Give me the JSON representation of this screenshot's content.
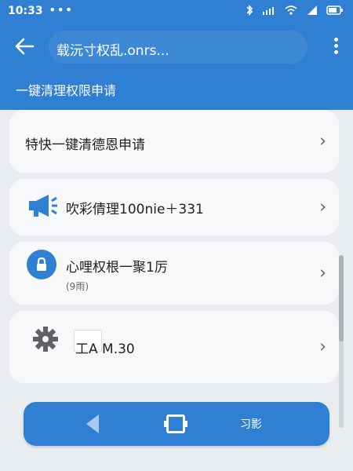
{
  "status": {
    "time": "10:33",
    "dots": "•••",
    "icons": [
      "bluetooth-icon",
      "signal-bars-icon",
      "wifi-icon",
      "cellular-icon",
      "battery-icon"
    ]
  },
  "appbar": {
    "title": "载沅寸权乱.onrs..."
  },
  "subtitle": "一键清理权限申请",
  "rows": [
    {
      "title": "特快一键清德恩申请"
    },
    {
      "title": "吹彩倩理100nie＋331"
    },
    {
      "title": "心哩权根一聚1厉",
      "subtitle": "(9雨)"
    },
    {
      "title": "工A M.30"
    }
  ],
  "bottom_nav": {
    "label": "习影"
  },
  "colors": {
    "primary": "#2f7fd2",
    "background": "#e9edf0"
  }
}
